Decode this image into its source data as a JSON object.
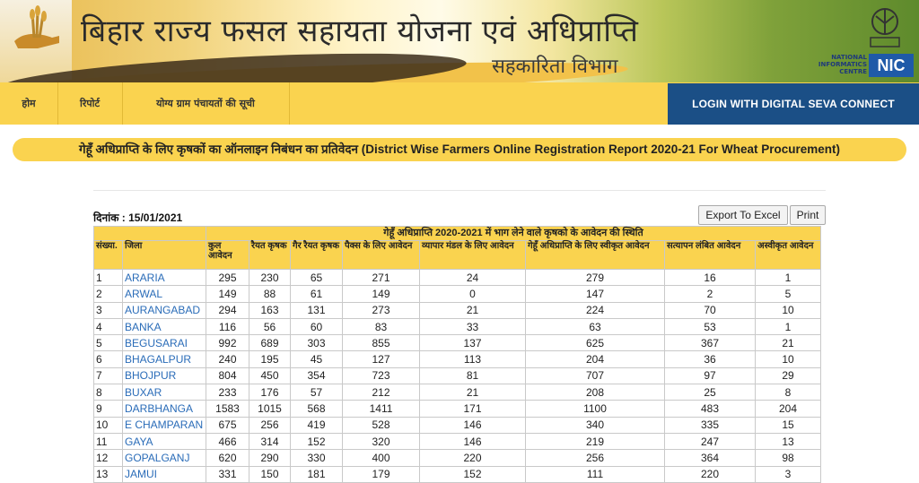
{
  "header": {
    "title": "बिहार राज्य फसल सहायता योजना एवं अधिप्राप्ति",
    "subtitle": "सहकारिता विभाग",
    "nic_text": "NATIONAL INFORMATICS CENTRE",
    "nic_logo": "NIC",
    "emblem_icon": "bihar-emblem-icon",
    "hand_logo_icon": "hand-wheat-logo-icon"
  },
  "nav": {
    "items": [
      {
        "label": "होम"
      },
      {
        "label": "रिपोर्ट"
      },
      {
        "label": "योग्य ग्राम पंचायतों की सूची"
      }
    ],
    "login_label": "LOGIN WITH DIGITAL SEVA CONNECT"
  },
  "report": {
    "heading": "गेहूँ अधिप्राप्ति के लिए कृषकों का ऑनलाइन निबंधन का प्रतिवेदन (District Wise Farmers Online Registration Report 2020-21 For Wheat Procurement)",
    "date_label": "दिनांक : 15/01/2021",
    "export_label": "Export To Excel",
    "print_label": "Print"
  },
  "table": {
    "group_header": "गेहूँ अधिप्राप्ति 2020-2021 में भाग लेने वाले कृषको के आवेदन की स्थिति",
    "columns": [
      "संख्या.",
      "जिला",
      "कुल आवेदन",
      "रैयत कृषक",
      "गैर रैयत कृषक",
      "पैक्स के लिए आवेदन",
      "व्यापार मंडल के लिए आवेदन",
      "गेहूँ अधिप्राप्ति के लिए स्वीकृत आवेदन",
      "सत्यापन लंबित आवेदन",
      "अस्वीकृत आवेदन"
    ],
    "rows": [
      [
        "1",
        "ARARIA",
        "295",
        "230",
        "65",
        "271",
        "24",
        "279",
        "16",
        "1"
      ],
      [
        "2",
        "ARWAL",
        "149",
        "88",
        "61",
        "149",
        "0",
        "147",
        "2",
        "5"
      ],
      [
        "3",
        "AURANGABAD",
        "294",
        "163",
        "131",
        "273",
        "21",
        "224",
        "70",
        "10"
      ],
      [
        "4",
        "BANKA",
        "116",
        "56",
        "60",
        "83",
        "33",
        "63",
        "53",
        "1"
      ],
      [
        "5",
        "BEGUSARAI",
        "992",
        "689",
        "303",
        "855",
        "137",
        "625",
        "367",
        "21"
      ],
      [
        "6",
        "BHAGALPUR",
        "240",
        "195",
        "45",
        "127",
        "113",
        "204",
        "36",
        "10"
      ],
      [
        "7",
        "BHOJPUR",
        "804",
        "450",
        "354",
        "723",
        "81",
        "707",
        "97",
        "29"
      ],
      [
        "8",
        "BUXAR",
        "233",
        "176",
        "57",
        "212",
        "21",
        "208",
        "25",
        "8"
      ],
      [
        "9",
        "DARBHANGA",
        "1583",
        "1015",
        "568",
        "1411",
        "171",
        "1100",
        "483",
        "204"
      ],
      [
        "10",
        "E CHAMPARAN",
        "675",
        "256",
        "419",
        "528",
        "146",
        "340",
        "335",
        "15"
      ],
      [
        "11",
        "GAYA",
        "466",
        "314",
        "152",
        "320",
        "146",
        "219",
        "247",
        "13"
      ],
      [
        "12",
        "GOPALGANJ",
        "620",
        "290",
        "330",
        "400",
        "220",
        "256",
        "364",
        "98"
      ],
      [
        "13",
        "JAMUI",
        "331",
        "150",
        "181",
        "179",
        "152",
        "111",
        "220",
        "3"
      ]
    ]
  }
}
